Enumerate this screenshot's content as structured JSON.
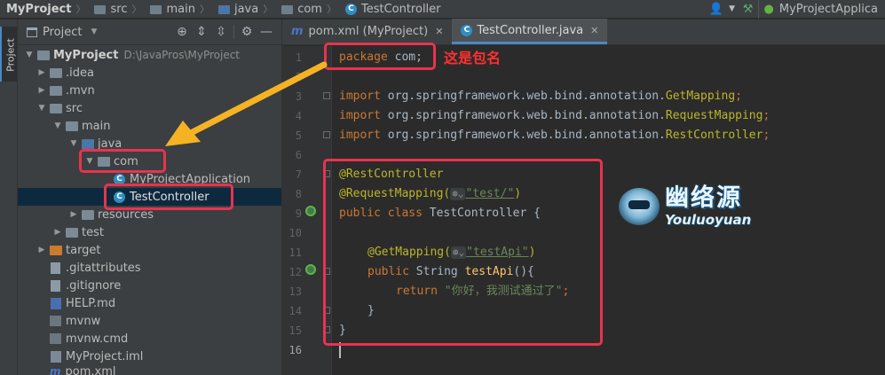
{
  "breadcrumb": {
    "project": "MyProject",
    "parts": [
      "src",
      "main",
      "java",
      "com"
    ],
    "current_file": "TestController",
    "run_config": "MyProjectApplica"
  },
  "icons": {
    "user": "user-icon",
    "hammer": "build-hammer-icon",
    "run": "run-config-icon",
    "locate": "target-locate-icon",
    "expand": "expand-all-icon",
    "collapse": "collapse-all-icon",
    "settings": "gear-icon",
    "hide": "minimize-icon"
  },
  "toolstrip": {
    "project_tab": "Project"
  },
  "project_panel": {
    "title": "Project",
    "tree": [
      {
        "label": "MyProject",
        "suffix": "D:\\JavaPros\\MyProject",
        "expanded": true
      },
      {
        "label": ".idea",
        "expanded": false
      },
      {
        "label": ".mvn",
        "expanded": false
      },
      {
        "label": "src",
        "expanded": true
      },
      {
        "label": "main",
        "expanded": true
      },
      {
        "label": "java",
        "expanded": true
      },
      {
        "label": "com",
        "expanded": true
      },
      {
        "label": "MyProjectApplication"
      },
      {
        "label": "TestController",
        "selected": true
      },
      {
        "label": "resources",
        "expanded": false
      },
      {
        "label": "test",
        "expanded": false
      },
      {
        "label": "target",
        "expanded": false
      },
      {
        "label": ".gitattributes"
      },
      {
        "label": ".gitignore"
      },
      {
        "label": "HELP.md"
      },
      {
        "label": "mvnw"
      },
      {
        "label": "mvnw.cmd"
      },
      {
        "label": "MyProject.iml"
      },
      {
        "label": "pom.xml"
      }
    ]
  },
  "editor": {
    "tabs": [
      {
        "label": "pom.xml (MyProject)",
        "active": false
      },
      {
        "label": "TestController.java",
        "active": true
      }
    ],
    "line_numbers": [
      "1",
      "2",
      "3",
      "4",
      "5",
      "6",
      "7",
      "8",
      "9",
      "10",
      "11",
      "12",
      "13",
      "14",
      "15",
      "16"
    ],
    "code": {
      "l1_kw": "package",
      "l1_rest": " com;",
      "l3_kw": "import",
      "l3_pkg": " org.springframework.web.bind.annotation.",
      "l3_cls": "GetMapping",
      "l4_cls": "RequestMapping",
      "l5_cls": "RestController",
      "semi": ";",
      "l7": "@RestController",
      "l8_an": "@RequestMapping(",
      "l8_str": "\"test/\"",
      "close_paren": ")",
      "l9_kw": "public class",
      "l9_rest": " TestController {",
      "l11_an": "@GetMapping(",
      "l11_str": "\"testApi\"",
      "l12_kw": "public",
      "l12_mid": " String ",
      "l12_fn": "testApi",
      "l12_end": "(){",
      "l13_kw": "return",
      "l13_str": " \"你好，我测试通过了\"",
      "l14": "}",
      "l15": "}",
      "hint": "⊛⌄"
    }
  },
  "annotations": {
    "package_note": "这是包名",
    "accent_color": "#e8334f"
  },
  "watermark": {
    "cn": "幽络源",
    "en": "Youluoyuan"
  }
}
